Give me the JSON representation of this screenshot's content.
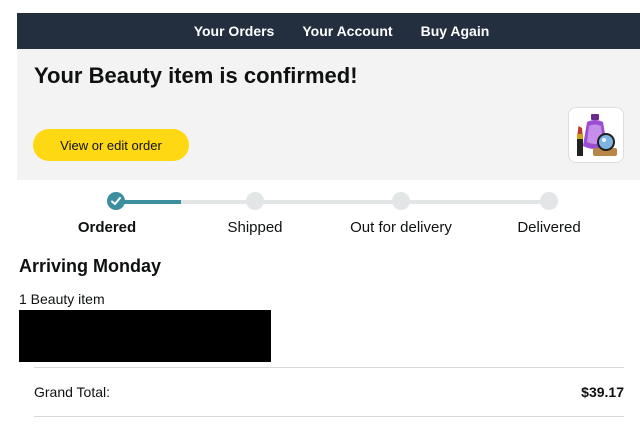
{
  "nav": {
    "orders_label": "Your Orders",
    "account_label": "Your Account",
    "buy_again_label": "Buy Again"
  },
  "hero": {
    "title": "Your Beauty item is confirmed!",
    "edit_button_label": "View or edit order",
    "thumbnail_icon": "beauty-products-icon"
  },
  "progress": {
    "steps": [
      {
        "label": "Ordered",
        "completed": true,
        "current": true
      },
      {
        "label": "Shipped",
        "completed": false,
        "current": false
      },
      {
        "label": "Out for delivery",
        "completed": false,
        "current": false
      },
      {
        "label": "Delivered",
        "completed": false,
        "current": false
      }
    ],
    "accent_color": "#3d8fa0"
  },
  "delivery": {
    "arriving": "Arriving Monday",
    "item_count": "1 Beauty item"
  },
  "totals": {
    "label": "Grand Total:",
    "value": "$39.17"
  },
  "colors": {
    "nav_bg": "#232f3e",
    "button_bg": "#ffd814",
    "hero_bg": "#f3f3f3"
  }
}
